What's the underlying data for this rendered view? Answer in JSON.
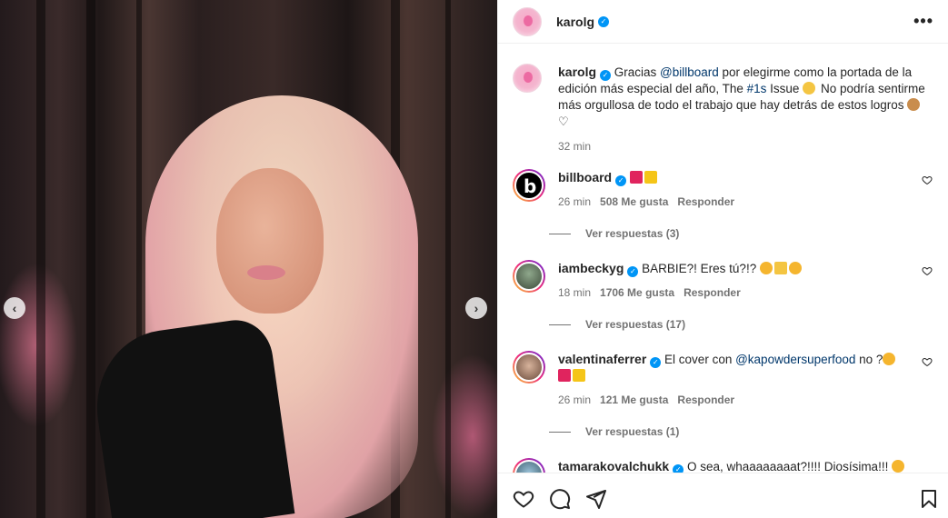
{
  "media": {
    "prev_glyph": "‹",
    "next_glyph": "›"
  },
  "header": {
    "username": "karolg",
    "verified_icon": "verified-badge-icon",
    "more_glyph": "•••"
  },
  "caption": {
    "username": "karolg",
    "text_1": " Gracias ",
    "mention": "@billboard",
    "text_2": " por elegirme como la portada de la edición más especial del año, The ",
    "hashtag": "#1s",
    "text_3": " Issue ",
    "text_4": " No podría sentirme más orgullosa de todo el trabajo que hay detrás de estos logros ",
    "time": "32 min"
  },
  "comments": [
    {
      "username": "billboard",
      "text": "",
      "time": "26 min",
      "likes": "508 Me gusta",
      "reply_label": "Responder",
      "view_replies": "Ver respuestas (3)",
      "emojis": [
        "heart-emoji",
        "crown-emoji"
      ]
    },
    {
      "username": "iambeckyg",
      "text": "BARBIE?! Eres tú?!?",
      "time": "18 min",
      "likes": "1706 Me gusta",
      "reply_label": "Responder",
      "view_replies": "Ver respuestas (17)",
      "emojis": [
        "star-eyes-emoji",
        "sparkles-emoji",
        "smile-emoji"
      ]
    },
    {
      "username": "valentinaferrer",
      "text_1": "El cover con ",
      "mention": "@kapowdersuperfood",
      "text_2": " no ?",
      "time": "26 min",
      "likes": "121 Me gusta",
      "reply_label": "Responder",
      "view_replies": "Ver respuestas (1)",
      "emojis": [
        "laughing-emoji",
        "heart-emoji",
        "raised-hands-emoji"
      ]
    },
    {
      "username": "tamarakovalchukk",
      "text": "O sea, whaaaaaaaat?!!!! Diosísima!!!",
      "emojis": [
        "star-eyes-emoji"
      ]
    }
  ],
  "actions": {
    "like_icon": "heart-outline-icon",
    "comment_icon": "comment-icon",
    "share_icon": "send-icon",
    "save_icon": "bookmark-icon"
  },
  "colors": {
    "link": "#00376b",
    "verified": "#0095f6",
    "meta": "#737373"
  }
}
